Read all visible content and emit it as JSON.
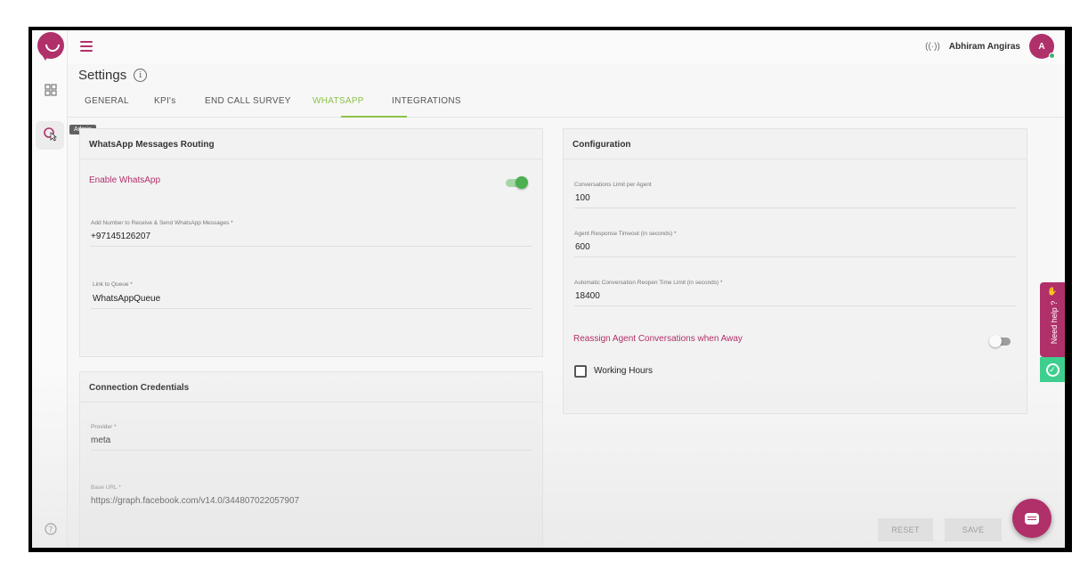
{
  "topbar": {
    "user_name": "Abhiram Angiras",
    "avatar_initial": "A"
  },
  "sidebar": {
    "tooltip": "Admin"
  },
  "page": {
    "title": "Settings",
    "info_glyph": "i"
  },
  "tabs": [
    {
      "label": "GENERAL"
    },
    {
      "label": "KPI's"
    },
    {
      "label": "END CALL SURVEY"
    },
    {
      "label": "WHATSAPP",
      "active": true
    },
    {
      "label": "INTEGRATIONS"
    }
  ],
  "routing": {
    "title": "WhatsApp Messages Routing",
    "enable_label": "Enable WhatsApp",
    "enable_state": "on",
    "number_label": "Add Number to Receive & Send WhatsApp Messages *",
    "number_value": "+97145126207",
    "queue_label": "Link to Queue *",
    "queue_value": "WhatsAppQueue"
  },
  "credentials": {
    "title": "Connection Credentials",
    "provider_label": "Provider *",
    "provider_value": "meta",
    "base_url_label": "Base URL *",
    "base_url_value": "https://graph.facebook.com/v14.0/344807022057907"
  },
  "configuration": {
    "title": "Configuration",
    "limit_label": "Conversations Limit per Agent",
    "limit_value": "100",
    "timeout_label": "Agent Response Timeout (in seconds) *",
    "timeout_value": "600",
    "reopen_label": "Automatic Conversation Reopen Time Limit (in seconds) *",
    "reopen_value": "18400",
    "reassign_label": "Reassign Agent Conversations when Away",
    "reassign_state": "off",
    "working_hours_label": "Working Hours",
    "working_hours_checked": false
  },
  "widgets": {
    "need_help": "Need help ?"
  },
  "actions": {
    "reset_label": "RESET",
    "save_label": "SAVE"
  },
  "colors": {
    "brand": "#b0306a",
    "tab_active": "#8bc34a",
    "toggle_on": "#4caf50",
    "check_widget": "#3ecf8e"
  },
  "icons": {
    "menu": "hamburger-icon",
    "dashboard": "dashboard-grid-icon",
    "admin": "admin-pointer-icon",
    "help": "help-circle-icon",
    "broadcast": "broadcast-icon",
    "info": "info-icon",
    "chat": "chat-icon",
    "check": "check-circle-icon"
  }
}
